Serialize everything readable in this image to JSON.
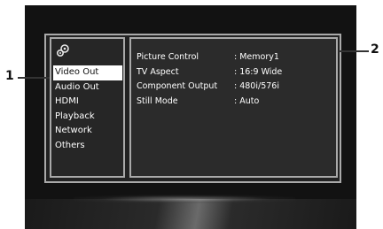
{
  "callouts": {
    "left": "1",
    "right": "2"
  },
  "sidebar": {
    "icon": "gear-icon",
    "items": [
      {
        "label": "Video Out",
        "selected": true
      },
      {
        "label": "Audio Out",
        "selected": false
      },
      {
        "label": "HDMI",
        "selected": false
      },
      {
        "label": "Playback",
        "selected": false
      },
      {
        "label": "Network",
        "selected": false
      },
      {
        "label": "Others",
        "selected": false
      }
    ]
  },
  "settings": [
    {
      "label": "Picture Control",
      "value": ": Memory1"
    },
    {
      "label": "TV Aspect",
      "value": ": 16:9 Wide"
    },
    {
      "label": "Component Output",
      "value": ": 480i/576i"
    },
    {
      "label": "Still Mode",
      "value": ": Auto"
    }
  ],
  "colors": {
    "screen_bg": "#121212",
    "panel_border": "#a9a9a9",
    "selected_bg": "#ffffff",
    "text": "#ffffff"
  }
}
